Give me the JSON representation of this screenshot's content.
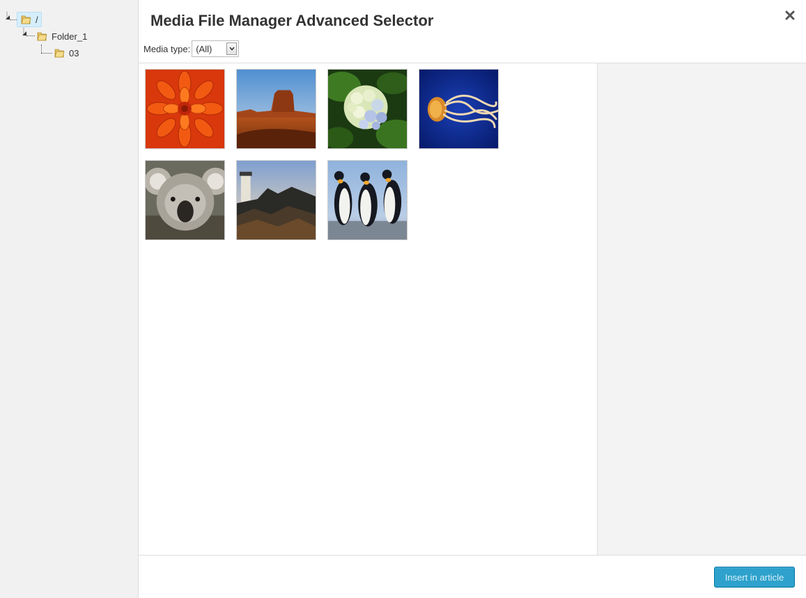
{
  "tree": {
    "root": {
      "label": "/",
      "icon": "folder-icon"
    },
    "folder_1": {
      "label": "Folder_1",
      "icon": "folder-icon"
    },
    "folder_03": {
      "label": "03",
      "icon": "folder-icon"
    }
  },
  "header": {
    "title": "Media File Manager Advanced Selector",
    "close_icon": "close-icon"
  },
  "filter": {
    "label": "Media type:",
    "selected": "(All)"
  },
  "thumbnails": [
    {
      "subject": "chrysanthemum"
    },
    {
      "subject": "desert"
    },
    {
      "subject": "hydrangeas"
    },
    {
      "subject": "jellyfish"
    },
    {
      "subject": "koala"
    },
    {
      "subject": "lighthouse"
    },
    {
      "subject": "penguins"
    }
  ],
  "footer": {
    "insert_label": "Insert in article"
  },
  "colors": {
    "accent": "#2ea2cc",
    "sidebar_bg": "#f1f1f1",
    "details_bg": "#f3f3f3"
  }
}
